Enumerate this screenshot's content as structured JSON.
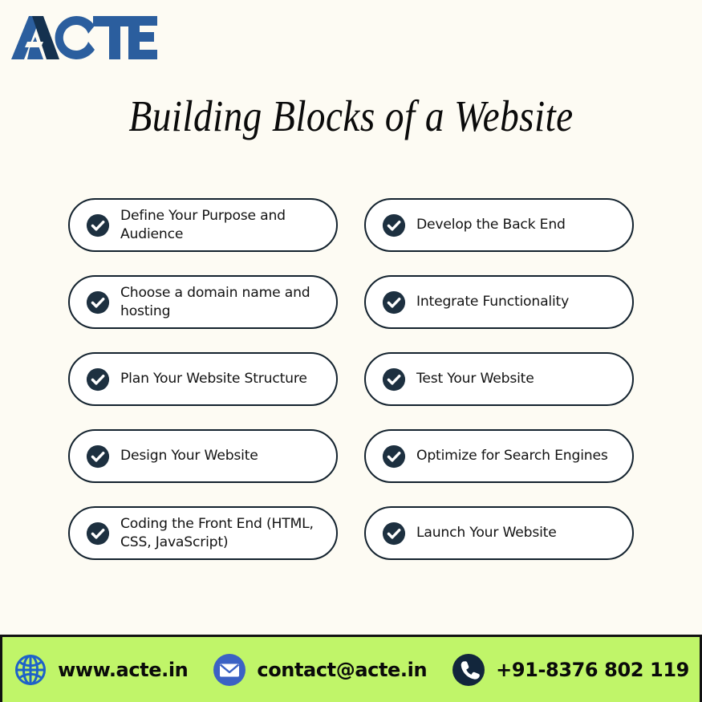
{
  "brand": {
    "logo_text": "ACTE",
    "logo_blue": "#2b5e9e",
    "logo_navy": "#14314f"
  },
  "page": {
    "background_color": "#fdfbf3",
    "title": "Building Blocks of a Website"
  },
  "checklist": {
    "accent_color": "#1d3040",
    "border_color": "#13222e",
    "items": [
      {
        "label": "Define Your Purpose and Audience",
        "icon": "check-circle-icon"
      },
      {
        "label": "Develop the Back End",
        "icon": "check-circle-icon"
      },
      {
        "label": "Choose a domain name and hosting",
        "icon": "check-circle-icon"
      },
      {
        "label": "Integrate Functionality",
        "icon": "check-circle-icon"
      },
      {
        "label": "Plan Your Website Structure",
        "icon": "check-circle-icon"
      },
      {
        "label": "Test Your Website",
        "icon": "check-circle-icon"
      },
      {
        "label": "Design Your Website",
        "icon": "check-circle-icon"
      },
      {
        "label": "Optimize for Search Engines",
        "icon": "check-circle-icon"
      },
      {
        "label": "Coding the Front End (HTML, CSS, JavaScript)",
        "icon": "check-circle-icon"
      },
      {
        "label": "Launch Your Website",
        "icon": "check-circle-icon"
      }
    ]
  },
  "footer": {
    "background_color": "#c0f569",
    "border_color": "#111111",
    "contacts": [
      {
        "icon": "globe-icon",
        "text": "www.acte.in",
        "icon_color": "#1e62c8"
      },
      {
        "icon": "mail-icon",
        "text": "contact@acte.in",
        "icon_color": "#3b62c4"
      },
      {
        "icon": "phone-icon",
        "text": "+91-8376 802 119",
        "icon_color": "#12263c"
      }
    ]
  }
}
